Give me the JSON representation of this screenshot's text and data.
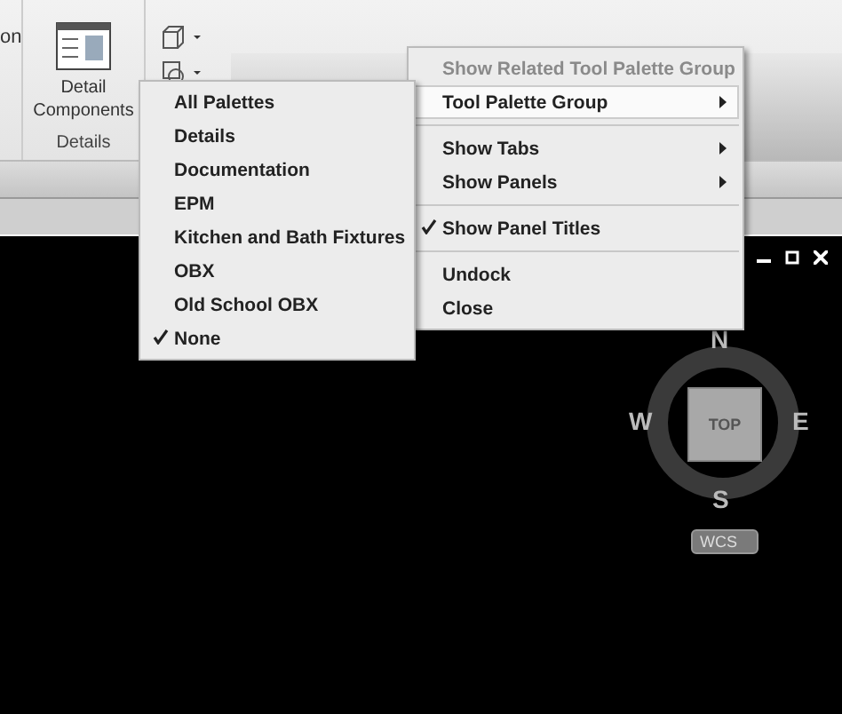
{
  "ribbon": {
    "cut_label": "on",
    "detail_button": {
      "line_1": "Detail",
      "line_2": "Components"
    },
    "panel_title": "Details"
  },
  "palette_menu": {
    "items": [
      {
        "label": "All Palettes",
        "selected": false
      },
      {
        "label": "Details",
        "selected": false
      },
      {
        "label": "Documentation",
        "selected": false
      },
      {
        "label": "EPM",
        "selected": false
      },
      {
        "label": "Kitchen and Bath Fixtures",
        "selected": false
      },
      {
        "label": "OBX",
        "selected": false
      },
      {
        "label": "Old School OBX",
        "selected": false
      },
      {
        "label": "None",
        "selected": true
      }
    ]
  },
  "context_menu": {
    "groups": [
      [
        {
          "label": "Show Related Tool Palette Group",
          "disabled": true,
          "submenu": false,
          "checked": false,
          "highlighted": false
        },
        {
          "label": "Tool Palette Group",
          "disabled": false,
          "submenu": true,
          "checked": false,
          "highlighted": true
        }
      ],
      [
        {
          "label": "Show Tabs",
          "disabled": false,
          "submenu": true,
          "checked": false,
          "highlighted": false
        },
        {
          "label": "Show Panels",
          "disabled": false,
          "submenu": true,
          "checked": false,
          "highlighted": false
        }
      ],
      [
        {
          "label": "Show Panel Titles",
          "disabled": false,
          "submenu": false,
          "checked": true,
          "highlighted": false
        }
      ],
      [
        {
          "label": "Undock",
          "disabled": false,
          "submenu": false,
          "checked": false,
          "highlighted": false
        },
        {
          "label": "Close",
          "disabled": false,
          "submenu": false,
          "checked": false,
          "highlighted": false
        }
      ]
    ]
  },
  "viewcube": {
    "face": "TOP",
    "north": "N",
    "east": "E",
    "south": "S",
    "west": "W",
    "coordinate_system": "WCS"
  }
}
